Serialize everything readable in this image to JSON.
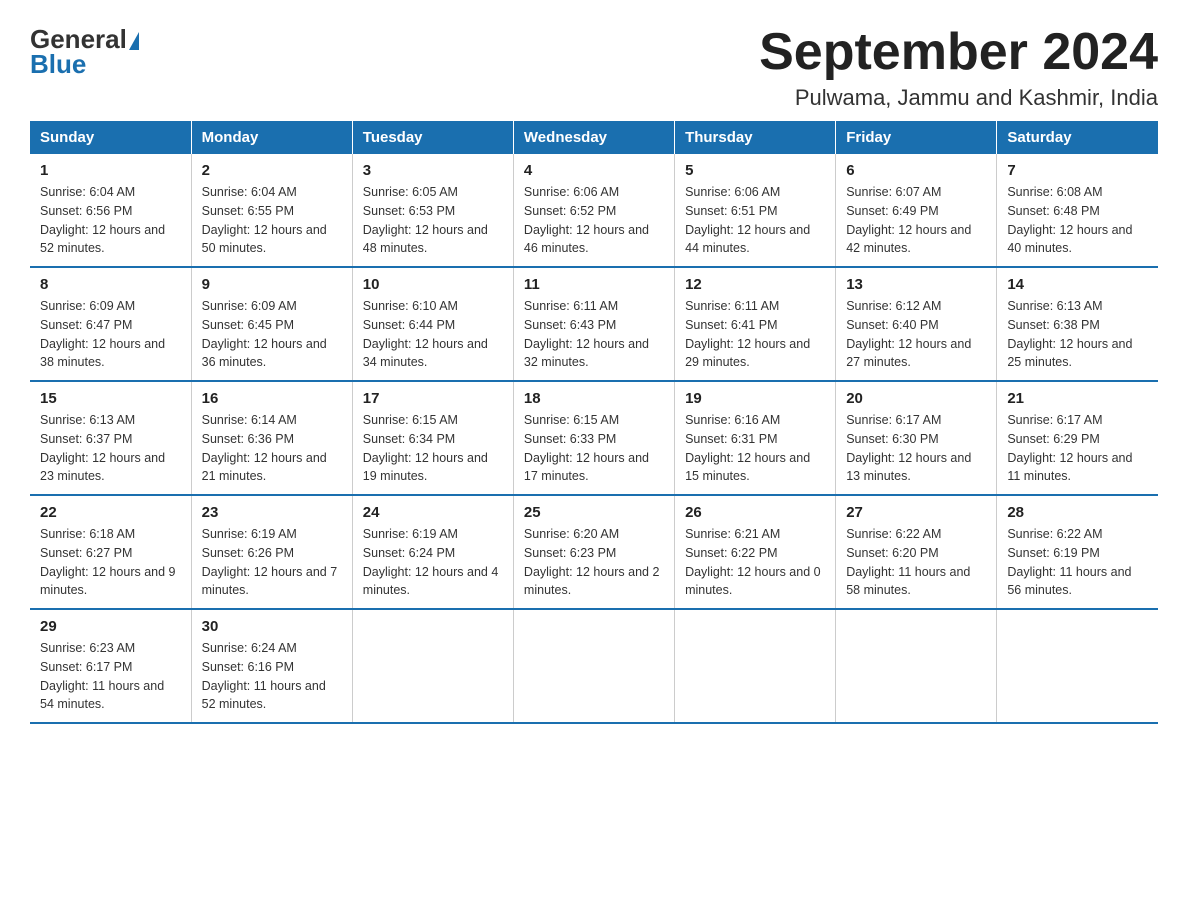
{
  "logo": {
    "general": "General",
    "blue": "Blue"
  },
  "title": "September 2024",
  "subtitle": "Pulwama, Jammu and Kashmir, India",
  "weekdays": [
    "Sunday",
    "Monday",
    "Tuesday",
    "Wednesday",
    "Thursday",
    "Friday",
    "Saturday"
  ],
  "weeks": [
    [
      {
        "day": "1",
        "sunrise": "6:04 AM",
        "sunset": "6:56 PM",
        "daylight": "12 hours and 52 minutes."
      },
      {
        "day": "2",
        "sunrise": "6:04 AM",
        "sunset": "6:55 PM",
        "daylight": "12 hours and 50 minutes."
      },
      {
        "day": "3",
        "sunrise": "6:05 AM",
        "sunset": "6:53 PM",
        "daylight": "12 hours and 48 minutes."
      },
      {
        "day": "4",
        "sunrise": "6:06 AM",
        "sunset": "6:52 PM",
        "daylight": "12 hours and 46 minutes."
      },
      {
        "day": "5",
        "sunrise": "6:06 AM",
        "sunset": "6:51 PM",
        "daylight": "12 hours and 44 minutes."
      },
      {
        "day": "6",
        "sunrise": "6:07 AM",
        "sunset": "6:49 PM",
        "daylight": "12 hours and 42 minutes."
      },
      {
        "day": "7",
        "sunrise": "6:08 AM",
        "sunset": "6:48 PM",
        "daylight": "12 hours and 40 minutes."
      }
    ],
    [
      {
        "day": "8",
        "sunrise": "6:09 AM",
        "sunset": "6:47 PM",
        "daylight": "12 hours and 38 minutes."
      },
      {
        "day": "9",
        "sunrise": "6:09 AM",
        "sunset": "6:45 PM",
        "daylight": "12 hours and 36 minutes."
      },
      {
        "day": "10",
        "sunrise": "6:10 AM",
        "sunset": "6:44 PM",
        "daylight": "12 hours and 34 minutes."
      },
      {
        "day": "11",
        "sunrise": "6:11 AM",
        "sunset": "6:43 PM",
        "daylight": "12 hours and 32 minutes."
      },
      {
        "day": "12",
        "sunrise": "6:11 AM",
        "sunset": "6:41 PM",
        "daylight": "12 hours and 29 minutes."
      },
      {
        "day": "13",
        "sunrise": "6:12 AM",
        "sunset": "6:40 PM",
        "daylight": "12 hours and 27 minutes."
      },
      {
        "day": "14",
        "sunrise": "6:13 AM",
        "sunset": "6:38 PM",
        "daylight": "12 hours and 25 minutes."
      }
    ],
    [
      {
        "day": "15",
        "sunrise": "6:13 AM",
        "sunset": "6:37 PM",
        "daylight": "12 hours and 23 minutes."
      },
      {
        "day": "16",
        "sunrise": "6:14 AM",
        "sunset": "6:36 PM",
        "daylight": "12 hours and 21 minutes."
      },
      {
        "day": "17",
        "sunrise": "6:15 AM",
        "sunset": "6:34 PM",
        "daylight": "12 hours and 19 minutes."
      },
      {
        "day": "18",
        "sunrise": "6:15 AM",
        "sunset": "6:33 PM",
        "daylight": "12 hours and 17 minutes."
      },
      {
        "day": "19",
        "sunrise": "6:16 AM",
        "sunset": "6:31 PM",
        "daylight": "12 hours and 15 minutes."
      },
      {
        "day": "20",
        "sunrise": "6:17 AM",
        "sunset": "6:30 PM",
        "daylight": "12 hours and 13 minutes."
      },
      {
        "day": "21",
        "sunrise": "6:17 AM",
        "sunset": "6:29 PM",
        "daylight": "12 hours and 11 minutes."
      }
    ],
    [
      {
        "day": "22",
        "sunrise": "6:18 AM",
        "sunset": "6:27 PM",
        "daylight": "12 hours and 9 minutes."
      },
      {
        "day": "23",
        "sunrise": "6:19 AM",
        "sunset": "6:26 PM",
        "daylight": "12 hours and 7 minutes."
      },
      {
        "day": "24",
        "sunrise": "6:19 AM",
        "sunset": "6:24 PM",
        "daylight": "12 hours and 4 minutes."
      },
      {
        "day": "25",
        "sunrise": "6:20 AM",
        "sunset": "6:23 PM",
        "daylight": "12 hours and 2 minutes."
      },
      {
        "day": "26",
        "sunrise": "6:21 AM",
        "sunset": "6:22 PM",
        "daylight": "12 hours and 0 minutes."
      },
      {
        "day": "27",
        "sunrise": "6:22 AM",
        "sunset": "6:20 PM",
        "daylight": "11 hours and 58 minutes."
      },
      {
        "day": "28",
        "sunrise": "6:22 AM",
        "sunset": "6:19 PM",
        "daylight": "11 hours and 56 minutes."
      }
    ],
    [
      {
        "day": "29",
        "sunrise": "6:23 AM",
        "sunset": "6:17 PM",
        "daylight": "11 hours and 54 minutes."
      },
      {
        "day": "30",
        "sunrise": "6:24 AM",
        "sunset": "6:16 PM",
        "daylight": "11 hours and 52 minutes."
      },
      null,
      null,
      null,
      null,
      null
    ]
  ]
}
